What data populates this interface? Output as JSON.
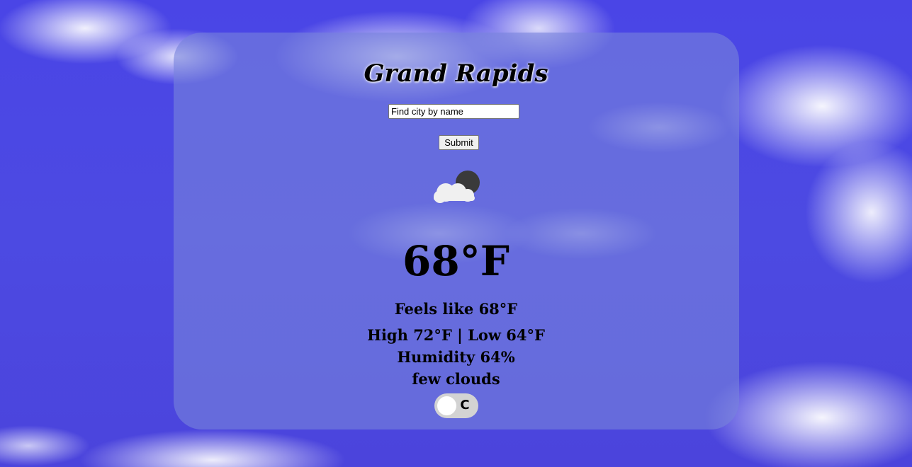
{
  "location": {
    "city": "Grand Rapids"
  },
  "search": {
    "placeholder": "Find city by name",
    "value": "",
    "submit_label": "Submit"
  },
  "weather": {
    "icon": "few-clouds-night-icon",
    "temperature": "68°F",
    "feels_like": "Feels like 68°F",
    "high_low": "High 72°F | Low 64°F",
    "humidity": "Humidity 64%",
    "description": "few clouds"
  },
  "unit_toggle": {
    "label": "C",
    "checked": false
  },
  "colors": {
    "sky": "#4a45e0",
    "card": "#7882dc",
    "toggle_track": "#d3d3d3",
    "moon": "#3a3a3a",
    "cloud": "#f0f0f0"
  }
}
